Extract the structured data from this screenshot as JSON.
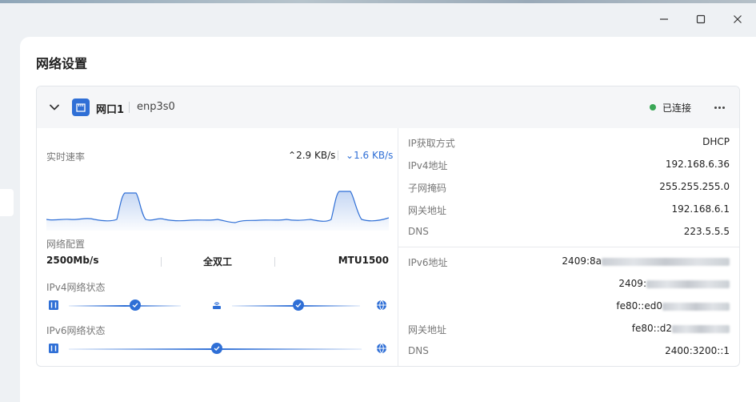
{
  "window": {
    "minimize_icon": "minimize-icon",
    "maximize_icon": "maximize-icon",
    "close_icon": "close-icon"
  },
  "page": {
    "title": "网络设置"
  },
  "interface": {
    "port_label": "网口1",
    "iface_name": "enp3s0",
    "status": "已连接",
    "status_color": "#3aa756",
    "accent": "#2f6fd6"
  },
  "realtime": {
    "label": "实时速率",
    "upload": "2.9 KB/s",
    "download": "1.6 KB/s"
  },
  "config": {
    "label": "网络配置",
    "speed": "2500Mb/s",
    "duplex": "全双工",
    "mtu": "MTU1500"
  },
  "ipv4_status": {
    "label": "IPv4网络状态"
  },
  "ipv6_status": {
    "label": "IPv6网络状态"
  },
  "ipv4": [
    {
      "key": "IP获取方式",
      "value": "DHCP"
    },
    {
      "key": "IPv4地址",
      "value": "192.168.6.36"
    },
    {
      "key": "子网掩码",
      "value": "255.255.255.0"
    },
    {
      "key": "网关地址",
      "value": "192.168.6.1"
    },
    {
      "key": "DNS",
      "value": "223.5.5.5"
    }
  ],
  "ipv6": {
    "address_label": "IPv6地址",
    "addresses": [
      "2409:8a",
      "2409:",
      "fe80::ed0"
    ],
    "gateway_label": "网关地址",
    "gateway": "fe80::d2",
    "dns_label": "DNS",
    "dns": "2400:3200::1"
  }
}
